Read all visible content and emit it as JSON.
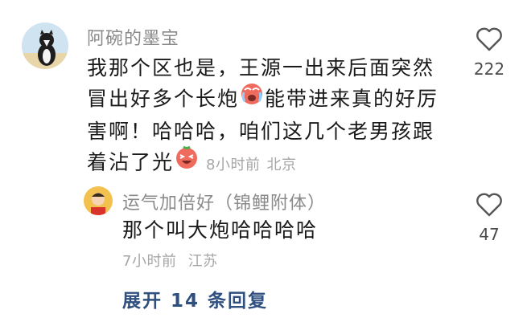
{
  "comment": {
    "username": "阿碗的墨宝",
    "line1": "我那个区也是，王源一出来后面突然",
    "line2a": "冒出好多个长炮",
    "line2b": "能带进来真的好厉",
    "line3": "害啊！哈哈哈，咱们这几个老男孩跟",
    "line4": "着沾了光",
    "time": "8小时前",
    "location": "北京",
    "like_count": "222"
  },
  "reply": {
    "username": "运气加倍好（锦鲤附体）",
    "text": "那个叫大炮哈哈哈哈",
    "time": "7小时前",
    "location": "江苏",
    "like_count": "47"
  },
  "expand_label": "展开 14 条回复",
  "icons": {
    "heart": "heart-outline-icon",
    "crying_emoji": "crying-face-emoji-icon",
    "laughing_emoji": "laughing-face-emoji-icon"
  },
  "colors": {
    "username": "#8a8a8a",
    "meta": "#a6a6a6",
    "link": "#2f4f7f",
    "emoji": "#ef6b5e"
  }
}
